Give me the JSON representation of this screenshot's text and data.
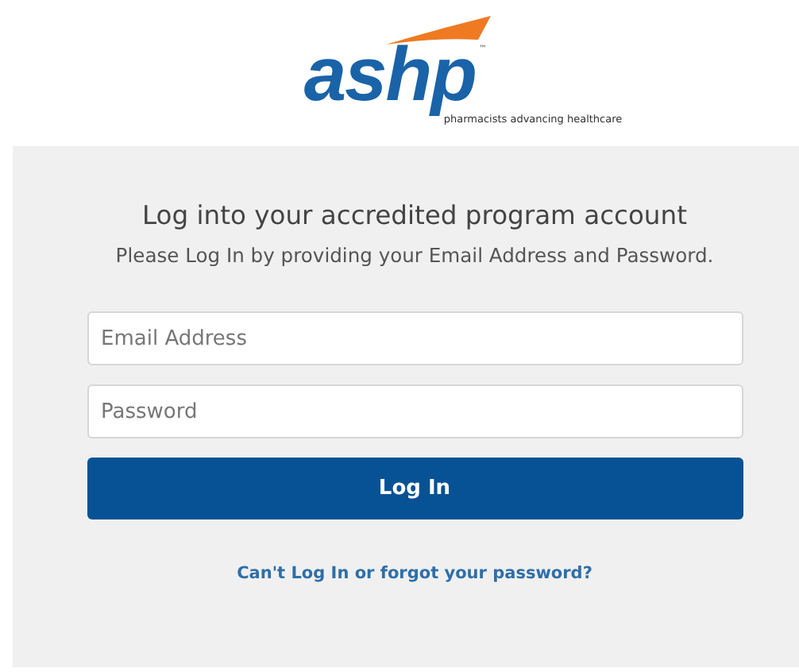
{
  "logo": {
    "wordmark": "ashp",
    "trademark": "™",
    "tagline": "pharmacists advancing healthcare"
  },
  "login": {
    "title": "Log into your accredited program account",
    "subtitle": "Please Log In by providing your Email Address and Password.",
    "email_field": {
      "placeholder": "Email Address"
    },
    "password_field": {
      "placeholder": "Password"
    },
    "submit": "Log In",
    "help_link": "Can't Log In or forgot your password?"
  }
}
